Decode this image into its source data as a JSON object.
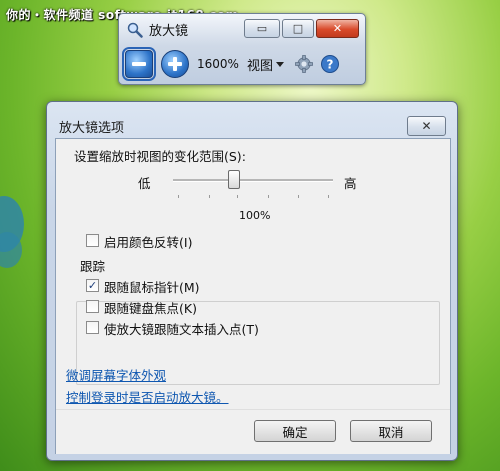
{
  "watermark": "你的・软件频道 software.it168.com",
  "colors": {
    "accent": "#2d73c8",
    "link": "#0f57b0",
    "close": "#d94a2b"
  },
  "magnifier": {
    "title": "放大镜",
    "window_controls": {
      "minimize": "▭",
      "maximize": "□",
      "close": "✕"
    },
    "zoom_out_icon": "minus-icon",
    "zoom_in_icon": "plus-icon",
    "zoom_level": "1600%",
    "view_label": "视图",
    "settings_icon": "gear-icon",
    "help_icon": "question-icon"
  },
  "dialog": {
    "title": "放大镜选项",
    "close_glyph": "✕",
    "zoom_range_label": "设置缩放时视图的变化范围(S):",
    "slider": {
      "low": "低",
      "high": "高",
      "value_text": "100%",
      "level_fraction": 0.38
    },
    "invert_colors": {
      "label": "启用颜色反转(I)",
      "checked": false
    },
    "tracking": {
      "title": "跟踪",
      "options": [
        {
          "label": "跟随鼠标指针(M)",
          "checked": true,
          "mark": "✓"
        },
        {
          "label": "跟随键盘焦点(K)",
          "checked": false,
          "mark": ""
        },
        {
          "label": "使放大镜跟随文本插入点(T)",
          "checked": false,
          "mark": ""
        }
      ]
    },
    "links": [
      "微调屏幕字体外观",
      "控制登录时是否启动放大镜。"
    ],
    "buttons": {
      "ok": "确定",
      "cancel": "取消"
    }
  }
}
